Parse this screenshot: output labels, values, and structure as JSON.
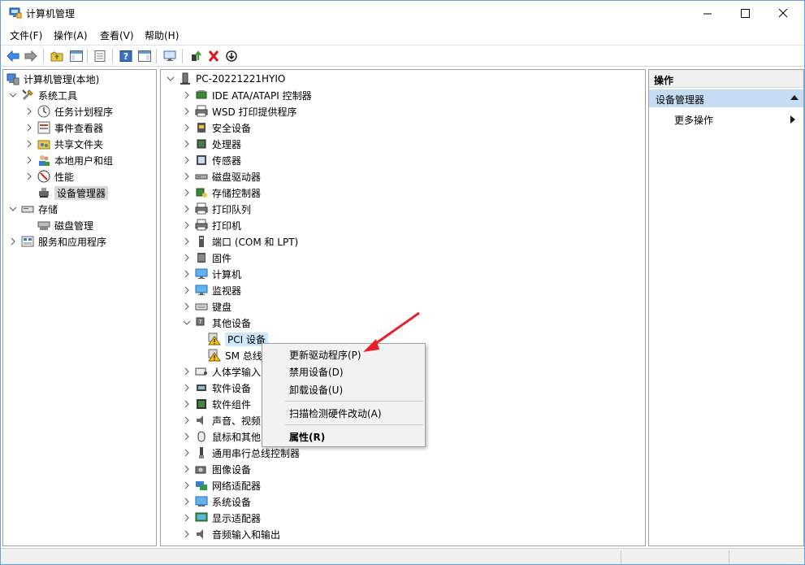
{
  "window": {
    "title": "计算机管理",
    "controls": {
      "minimize": "minimize",
      "maximize": "maximize",
      "close": "close"
    }
  },
  "menubar": [
    "文件(F)",
    "操作(A)",
    "查看(V)",
    "帮助(H)"
  ],
  "toolbar": {
    "icons": [
      "back-arrow-icon",
      "forward-arrow-icon",
      "up-folder-icon",
      "show-hide-tree-icon",
      "properties-icon",
      "help-icon",
      "action-pane-icon",
      "monitor-icon",
      "update-driver-icon",
      "uninstall-icon",
      "disable-device-icon"
    ]
  },
  "left_tree": {
    "root": "计算机管理(本地)",
    "system_tools": "系统工具",
    "items": [
      "任务计划程序",
      "事件查看器",
      "共享文件夹",
      "本地用户和组",
      "性能",
      "设备管理器"
    ],
    "storage": "存储",
    "disk_mgmt": "磁盘管理",
    "services": "服务和应用程序"
  },
  "device_tree": {
    "root": "PC-20221221HYIO",
    "categories": [
      "IDE ATA/ATAPI 控制器",
      "WSD 打印提供程序",
      "安全设备",
      "处理器",
      "传感器",
      "磁盘驱动器",
      "存储控制器",
      "打印队列",
      "打印机",
      "端口 (COM 和 LPT)",
      "固件",
      "计算机",
      "监视器",
      "键盘",
      "其他设备"
    ],
    "other_children": [
      "PCI 设备",
      "SM 总线"
    ],
    "categories_after": [
      "人体学输入",
      "软件设备",
      "软件组件",
      "声音、视频",
      "鼠标和其他",
      "通用串行总线控制器",
      "图像设备",
      "网络适配器",
      "系统设备",
      "显示适配器",
      "音频输入和输出"
    ]
  },
  "actions": {
    "header": "操作",
    "section": "设备管理器",
    "more": "更多操作"
  },
  "context_menu": {
    "update_driver": "更新驱动程序(P)",
    "disable": "禁用设备(D)",
    "uninstall": "卸载设备(U)",
    "scan": "扫描检测硬件改动(A)",
    "properties": "属性(R)"
  },
  "colors": {
    "accent_blue": "#0078d7",
    "selection_light": "#cde8ff",
    "actions_section": "#c5dcf2",
    "arrow_red": "#e8202a"
  }
}
